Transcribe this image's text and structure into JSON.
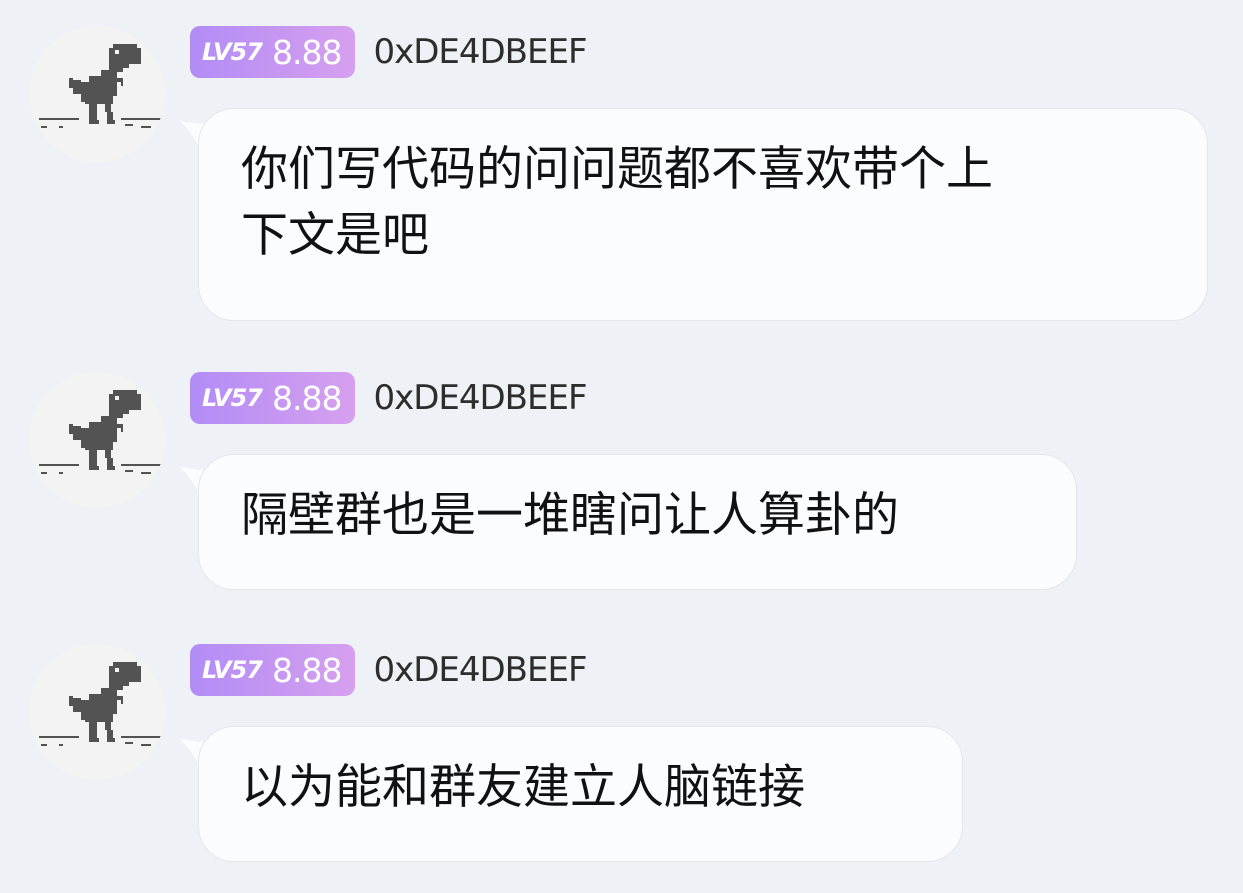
{
  "messages": [
    {
      "sender": {
        "level": "LV57",
        "score": "8.88",
        "name": "0xDE4DBEEF"
      },
      "text_lines": [
        "你们写代码的问问题都不喜欢带个上",
        "下文是吧"
      ]
    },
    {
      "sender": {
        "level": "LV57",
        "score": "8.88",
        "name": "0xDE4DBEEF"
      },
      "text_lines": [
        "隔壁群也是一堆瞎问让人算卦的"
      ]
    },
    {
      "sender": {
        "level": "LV57",
        "score": "8.88",
        "name": "0xDE4DBEEF"
      },
      "text_lines": [
        "以为能和群友建立人脑链接"
      ]
    }
  ],
  "colors": {
    "background": "#eef1f6",
    "bubble": "#fbfcfe",
    "badge_start": "#b28cf6",
    "badge_end": "#d6a0ee",
    "dino": "#535353"
  },
  "icons": {
    "avatar": "dinosaur-icon"
  }
}
